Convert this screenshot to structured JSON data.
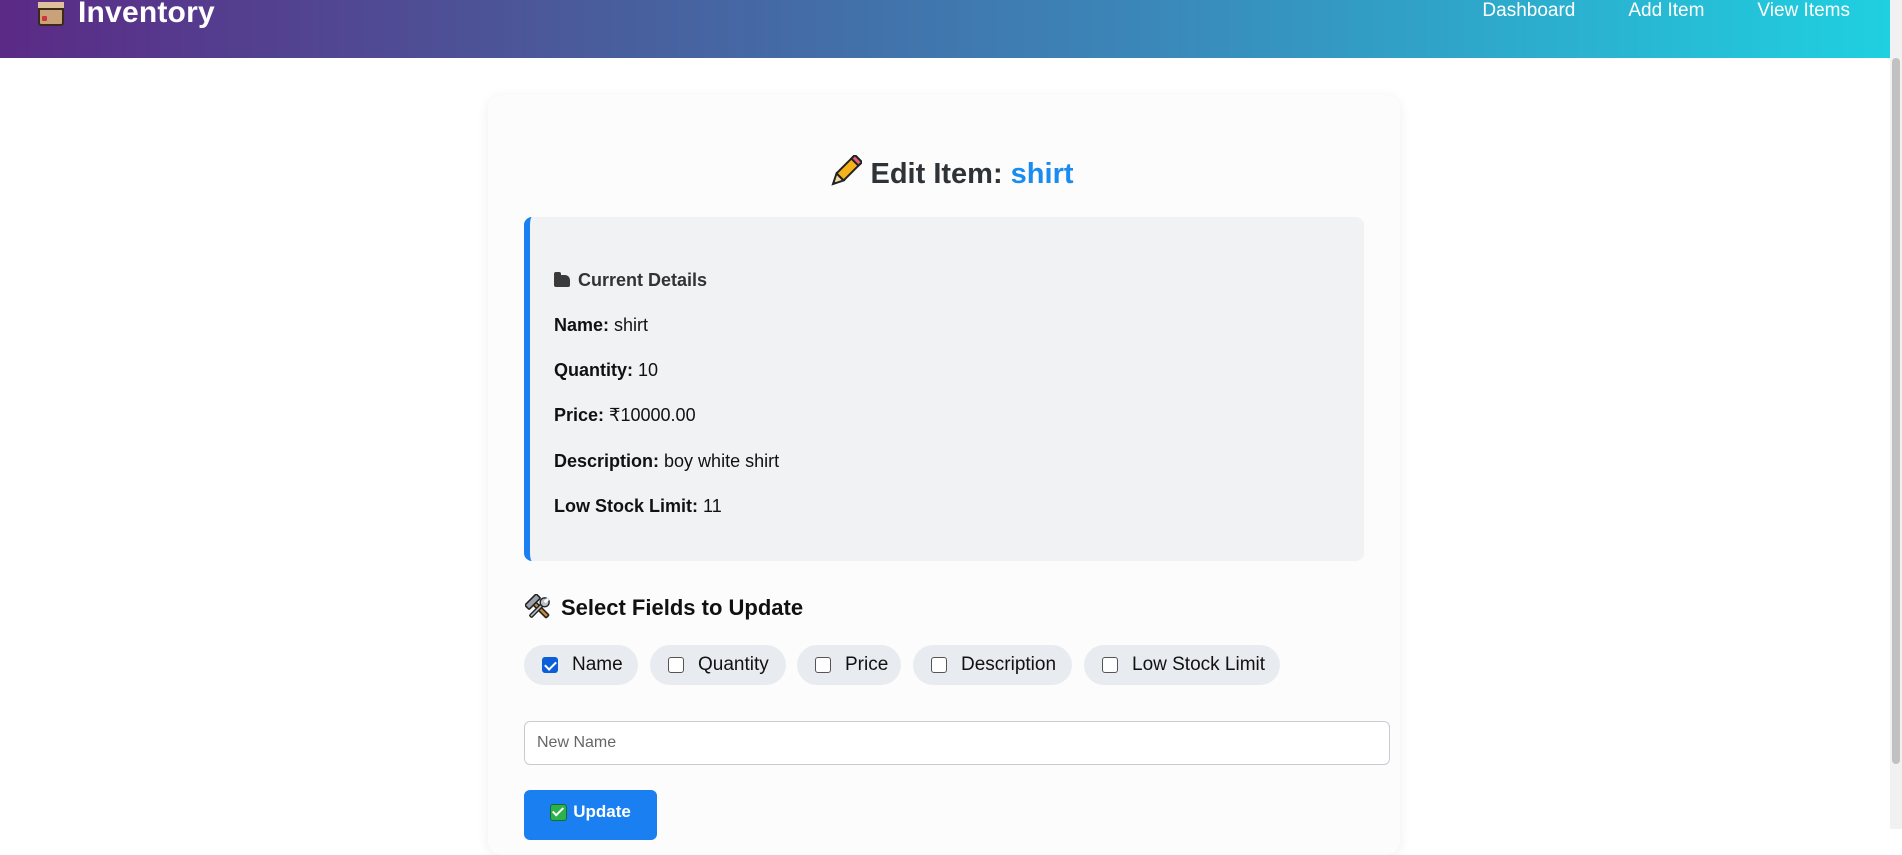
{
  "navbar": {
    "brand": "Inventory",
    "brand_icon": "package-box-icon",
    "links": [
      "Dashboard",
      "Add Item",
      "View Items"
    ]
  },
  "page": {
    "title_prefix": "Edit Item:",
    "item_name": "shirt",
    "title_icon": "pencil-icon",
    "accent_color": "#1a8cf0"
  },
  "current_details": {
    "heading": "Current Details",
    "heading_icon": "folder-icon",
    "rows": [
      {
        "label": "Name:",
        "value": "shirt"
      },
      {
        "label": "Quantity:",
        "value": "10"
      },
      {
        "label": "Price:",
        "value": "₹10000.00"
      },
      {
        "label": "Description:",
        "value": "boy white shirt"
      },
      {
        "label": "Low Stock Limit:",
        "value": "11"
      }
    ]
  },
  "update_section": {
    "heading": "Select Fields to Update",
    "heading_icon": "hammer-wrench-icon",
    "fields": [
      {
        "label": "Name",
        "checked": true
      },
      {
        "label": "Quantity",
        "checked": false
      },
      {
        "label": "Price",
        "checked": false
      },
      {
        "label": "Description",
        "checked": false
      },
      {
        "label": "Low Stock Limit",
        "checked": false
      }
    ],
    "new_name_placeholder": "New Name",
    "new_name_value": "",
    "submit_label": "Update",
    "submit_icon": "check-box-icon"
  }
}
